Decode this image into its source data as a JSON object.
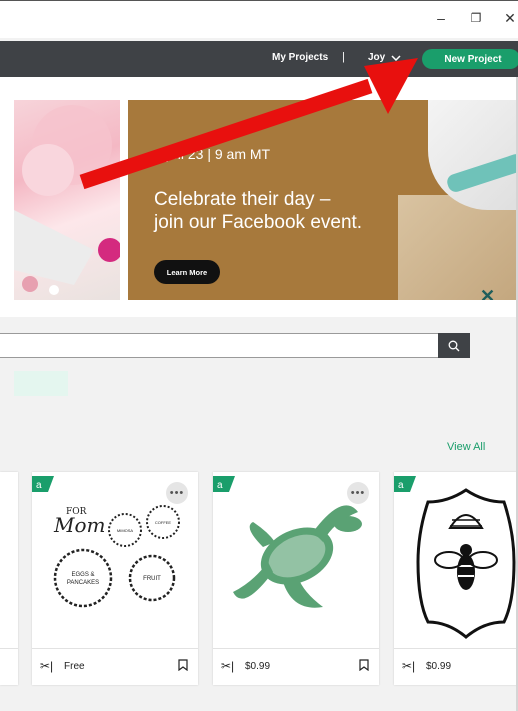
{
  "window": {
    "minimize_glyph": "–",
    "restore_glyph": "❐",
    "close_glyph": "✕"
  },
  "nav": {
    "my_projects": "My Projects",
    "separator": "|",
    "user_name": "Joy",
    "new_project": "New Project"
  },
  "banner": {
    "date_text": "April 23 | 9 am MT",
    "headline_line1": "Celebrate their day –",
    "headline_line2": "join our Facebook event.",
    "learn_more": "Learn More"
  },
  "search": {
    "placeholder": "",
    "icon": "search-icon"
  },
  "section": {
    "view_all": "View All"
  },
  "cards": [
    {
      "price": "Free",
      "design": "mom-wreath-labels",
      "labels": [
        "FOR",
        "Mom",
        "MIMOSA",
        "COFFEE",
        "EGGS &",
        "PANCAKES",
        "FRUIT"
      ]
    },
    {
      "price": "$0.99",
      "design": "sea-turtle"
    },
    {
      "price": "$0.99",
      "design": "bee-and-hive"
    }
  ],
  "colors": {
    "accent": "#1a9e6b",
    "navbar": "#3f4246",
    "banner": "#a7793c",
    "arrow": "#e8100e"
  }
}
